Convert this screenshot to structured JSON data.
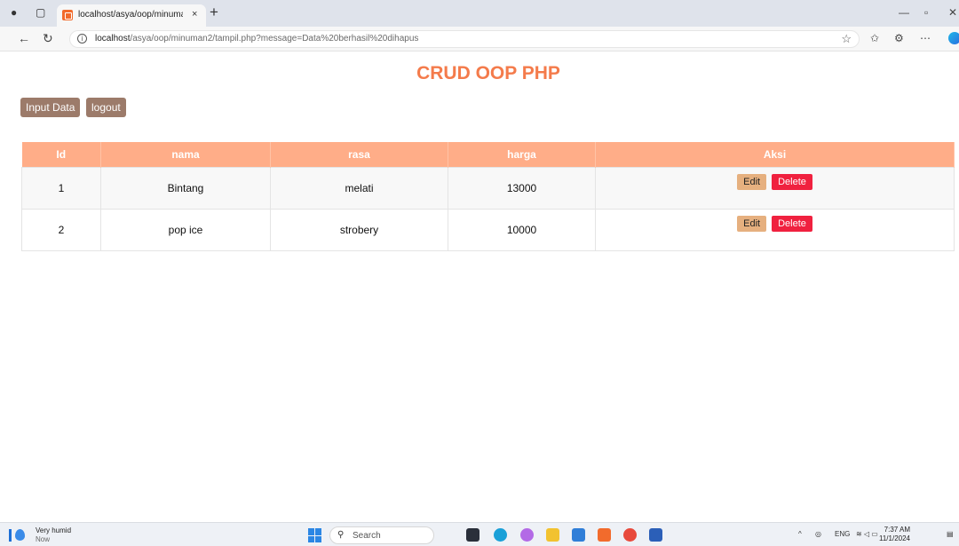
{
  "browser": {
    "tab_title": "localhost/asya/oop/minuman2/ta",
    "tab_close": "×",
    "new_tab": "+",
    "url_host": "localhost",
    "url_path": "/asya/oop/minuman2/tampil.php?message=Data%20berhasil%20dihapus"
  },
  "page": {
    "title": "CRUD OOP PHP",
    "buttons": {
      "input": "Input Data",
      "logout": "logout"
    }
  },
  "table": {
    "headers": [
      "Id",
      "nama",
      "rasa",
      "harga",
      "Aksi"
    ],
    "rows": [
      {
        "id": "1",
        "nama": "Bintang",
        "rasa": "melati",
        "harga": "13000"
      },
      {
        "id": "2",
        "nama": "pop ice",
        "rasa": "strobery",
        "harga": "10000"
      }
    ],
    "actions": {
      "edit": "Edit",
      "delete": "Delete"
    }
  },
  "taskbar": {
    "weather": "Very humid",
    "weather_sub": "Now",
    "search": "Search",
    "lang": "ENG",
    "time": "7:37 AM",
    "date": "11/1/2024"
  },
  "colors": {
    "title": "#f47b4b",
    "table_header": "#ffad88",
    "primary_button": "#9c7b6a",
    "edit_button": "#e6b07f",
    "delete_button": "#f0213f"
  }
}
